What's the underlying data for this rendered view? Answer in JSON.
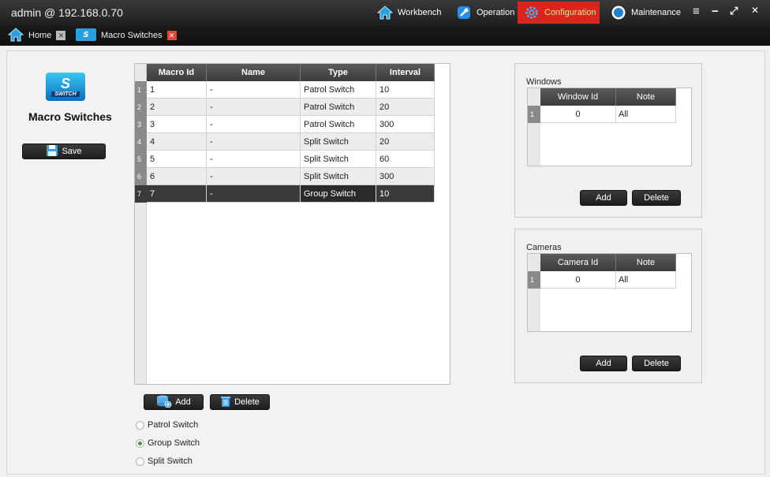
{
  "titlebar": {
    "title": "admin @ 192.168.0.70",
    "nav": [
      {
        "label": "Workbench",
        "icon": "home-icon"
      },
      {
        "label": "Operation",
        "icon": "wrench-icon"
      },
      {
        "label": "Configuration",
        "icon": "gear-icon",
        "active": true
      },
      {
        "label": "Maintenance",
        "icon": "circle-icon"
      }
    ],
    "controls": {
      "menu": "≡",
      "minimize": "−",
      "maximize": "⤢",
      "close": "✕"
    }
  },
  "tabs": [
    {
      "label": "Home",
      "icon": "home-icon"
    },
    {
      "label": "Macro Switches",
      "icon": "switch-icon"
    }
  ],
  "left": {
    "logo_text": "SWITCH",
    "logo_glyph": "S",
    "title": "Macro Switches",
    "save_label": "Save"
  },
  "macro_table": {
    "columns": [
      "Macro Id",
      "Name",
      "Type",
      "Interval"
    ],
    "rows": [
      {
        "num": "1",
        "id": "1",
        "name": "-",
        "type": "Patrol Switch",
        "interval": "10"
      },
      {
        "num": "2",
        "id": "2",
        "name": "-",
        "type": "Patrol Switch",
        "interval": "20"
      },
      {
        "num": "3",
        "id": "3",
        "name": "-",
        "type": "Patrol Switch",
        "interval": "300"
      },
      {
        "num": "4",
        "id": "4",
        "name": "-",
        "type": "Split Switch",
        "interval": "20"
      },
      {
        "num": "5",
        "id": "5",
        "name": "-",
        "type": "Split Switch",
        "interval": "60"
      },
      {
        "num": "6",
        "id": "6",
        "name": "-",
        "type": "Split Switch",
        "interval": "300"
      },
      {
        "num": "7",
        "id": "7",
        "name": "-",
        "type": "Group Switch",
        "interval": "10"
      }
    ],
    "selected_row": 7,
    "add_label": "Add",
    "delete_label": "Delete"
  },
  "switch_types": {
    "options": [
      "Patrol Switch",
      "Group Switch",
      "Split Switch"
    ],
    "selected": "Group Switch"
  },
  "windows_panel": {
    "title": "Windows",
    "columns": [
      "Window Id",
      "Note"
    ],
    "rows": [
      {
        "num": "1",
        "id": "0",
        "note": "All"
      }
    ],
    "add_label": "Add",
    "delete_label": "Delete"
  },
  "cameras_panel": {
    "title": "Cameras",
    "columns": [
      "Camera Id",
      "Note"
    ],
    "rows": [
      {
        "num": "1",
        "id": "0",
        "note": "All"
      }
    ],
    "add_label": "Add",
    "delete_label": "Delete"
  },
  "colors": {
    "active_nav": "#d9261c",
    "radio_selected": "#2ea82e",
    "header_dark": "#3c3c3c"
  }
}
